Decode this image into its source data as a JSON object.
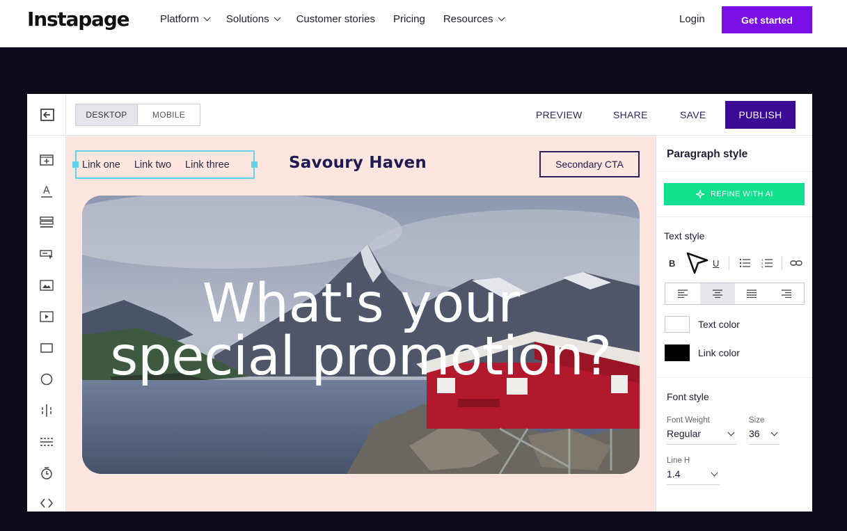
{
  "site_nav": {
    "logo": "Instapage",
    "items": [
      {
        "label": "Platform",
        "dropdown": true
      },
      {
        "label": "Solutions",
        "dropdown": true
      },
      {
        "label": "Customer stories",
        "dropdown": false
      },
      {
        "label": "Pricing",
        "dropdown": false
      },
      {
        "label": "Resources",
        "dropdown": true
      }
    ],
    "login": "Login",
    "cta": "Get started",
    "cta_color": "#7b10e6"
  },
  "editor": {
    "exit_icon": "exit-icon",
    "view_toggle": {
      "desktop": "DESKTOP",
      "mobile": "MOBILE",
      "selected": "DESKTOP"
    },
    "actions": {
      "preview": "PREVIEW",
      "share": "SHARE",
      "save": "SAVE",
      "publish": "PUBLISH"
    },
    "publish_color": "#3b0b95",
    "tools": [
      "add-section-icon",
      "text-icon",
      "form-icon",
      "button-icon",
      "image-icon",
      "video-icon",
      "box-icon",
      "circle-icon",
      "columns-icon",
      "divider-icon",
      "timer-icon",
      "code-icon"
    ]
  },
  "canvas": {
    "links": [
      "Link one",
      "Link two",
      "Link three"
    ],
    "brand": "Savoury Haven",
    "secondary_cta": "Secondary CTA",
    "hero_line1": "What's your",
    "hero_line2": "special promotion?",
    "background": "#fde6df"
  },
  "panel": {
    "title": "Paragraph style",
    "ai_button": "REFINE WITH AI",
    "ai_color": "#12e08f",
    "text_style": "Text style",
    "format_buttons": [
      "B",
      "I",
      "U"
    ],
    "alignment_selected": "center",
    "text_color_label": "Text color",
    "text_color": "#ffffff",
    "link_color_label": "Link color",
    "link_color": "#000000",
    "font_style": "Font style",
    "font_weight_label": "Font Weight",
    "font_weight": "Regular",
    "size_label": "Size",
    "size": "36",
    "line_height_label": "Line H",
    "line_height": "1.4"
  }
}
